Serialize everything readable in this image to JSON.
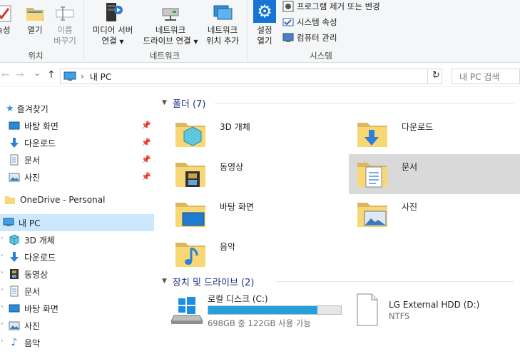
{
  "ribbon": {
    "buttons": {
      "properties": "속성",
      "open": "열기",
      "rename_line1": "이름",
      "rename_line2": "바꾸기",
      "media_line1": "미디어 서버",
      "media_line2": "연결",
      "map_line1": "네트워크",
      "map_line2": "드라이브 연결",
      "addloc_line1": "네트워크",
      "addloc_line2": "위치 추가",
      "settings_line1": "설정",
      "settings_line2": "열기"
    },
    "small": {
      "uninstall": "프로그램 제거 또는 변경",
      "sysprops": "시스템 속성",
      "manage": "컴퓨터 관리"
    },
    "groups": {
      "location": "위치",
      "network": "네트워크",
      "system": "시스템"
    }
  },
  "navbar": {
    "back": "←",
    "forward": "→",
    "recent": "⌄",
    "up": "↑",
    "path_sep": "›",
    "path": "내 PC",
    "dropdown": "⌄",
    "refresh": "↻",
    "search_placeholder": "내 PC 검색"
  },
  "sidebar": {
    "quick_access": "즐겨찾기",
    "quick_items": [
      "바탕 화면",
      "다운로드",
      "문서",
      "사진"
    ],
    "onedrive": "OneDrive - Personal",
    "this_pc": "내 PC",
    "pc_items": [
      "3D 개체",
      "다운로드",
      "동영상",
      "문서",
      "바탕 화면",
      "사진",
      "음악"
    ]
  },
  "content": {
    "folders_header": "폴더 (7)",
    "folders": [
      "3D 개체",
      "다운로드",
      "동영상",
      "문서",
      "바탕 화면",
      "사진",
      "음악"
    ],
    "devices_header": "장치 및 드라이브 (2)",
    "drives": [
      {
        "name": "로컬 디스크 (C:)",
        "detail": "698GB 중 122GB 사용 가능",
        "used_fraction": 0.825
      },
      {
        "name": "LG External HDD (D:)",
        "detail": "NTFS"
      }
    ]
  },
  "colors": {
    "accent": "#1e3287",
    "selection": "#cce8ff",
    "tile_selected": "#d9d9d9",
    "drive_bar": "#26a0da",
    "folder_yellow": "#f8d775"
  }
}
